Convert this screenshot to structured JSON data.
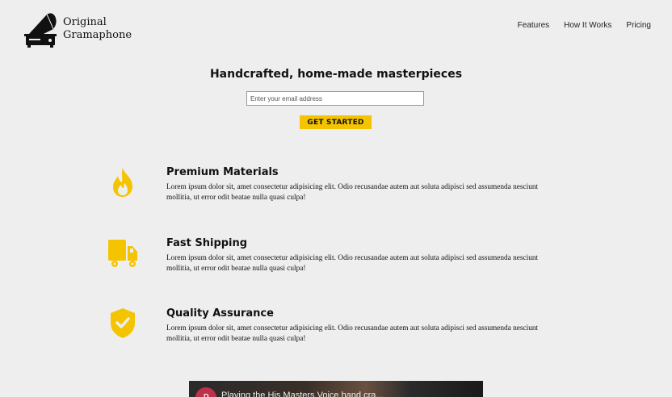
{
  "brand": {
    "line1": "Original",
    "line2": "Gramaphone"
  },
  "nav": [
    {
      "label": "Features"
    },
    {
      "label": "How It Works"
    },
    {
      "label": "Pricing"
    }
  ],
  "hero": {
    "title": "Handcrafted, home-made masterpieces",
    "email_placeholder": "Enter your email address",
    "cta_label": "GET STARTED"
  },
  "features": [
    {
      "icon": "fire-icon",
      "title": "Premium Materials",
      "description": "Lorem ipsum dolor sit, amet consectetur adipisicing elit. Odio recusandae autem aut soluta adipisci sed assumenda nesciunt mollitia, ut error odit beatae nulla quasi culpa!"
    },
    {
      "icon": "truck-icon",
      "title": "Fast Shipping",
      "description": "Lorem ipsum dolor sit, amet consectetur adipisicing elit. Odio recusandae autem aut soluta adipisci sed assumenda nesciunt mollitia, ut error odit beatae nulla quasi culpa!"
    },
    {
      "icon": "shield-check-icon",
      "title": "Quality Assurance",
      "description": "Lorem ipsum dolor sit, amet consectetur adipisicing elit. Odio recusandae autem aut soluta adipisci sed assumenda nesciunt mollitia, ut error odit beatae nulla quasi culpa!"
    }
  ],
  "video": {
    "channel_initial": "P",
    "title": "Playing the His Masters Voice hand cra..."
  },
  "colors": {
    "accent": "#f5c400",
    "background": "#eeeeee",
    "icon": "#f5c400"
  }
}
